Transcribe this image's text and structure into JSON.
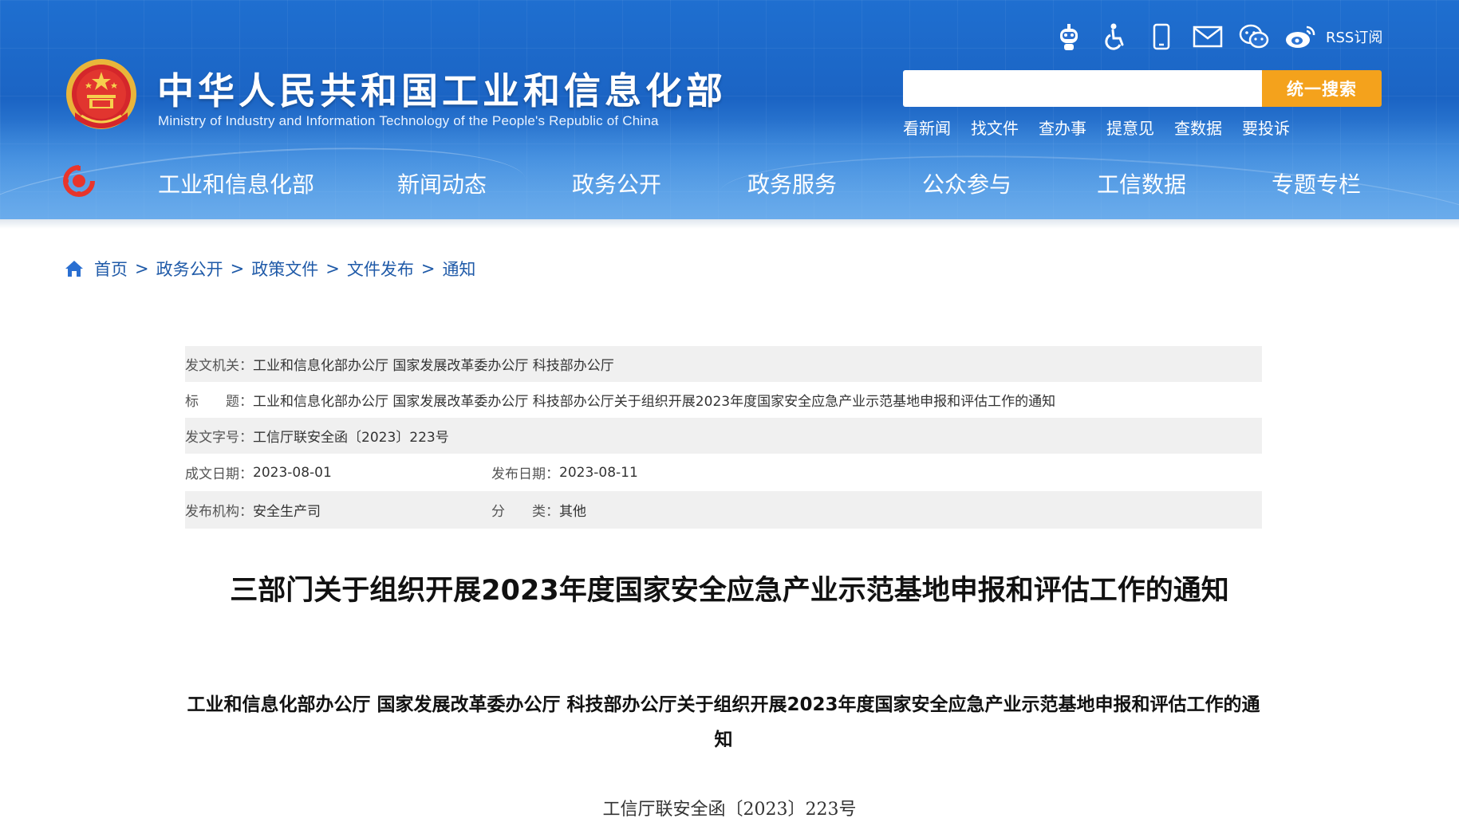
{
  "header": {
    "site_title": "中华人民共和国工业和信息化部",
    "site_subtitle": "Ministry of Industry and Information Technology of the People's Republic of China",
    "top_icons": [
      "robot-assistant-icon",
      "accessibility-icon",
      "mobile-icon",
      "mail-icon",
      "wechat-icon",
      "weibo-icon"
    ],
    "rss_label": "RSS订阅",
    "search": {
      "placeholder": "",
      "button_label": "统一搜索"
    },
    "quick_links": [
      "看新闻",
      "找文件",
      "查办事",
      "提意见",
      "查数据",
      "要投诉"
    ],
    "nav": [
      "工业和信息化部",
      "新闻动态",
      "政务公开",
      "政务服务",
      "公众参与",
      "工信数据",
      "专题专栏"
    ],
    "colors": {
      "header_blue": "#1f6fd0",
      "search_button": "#f4a21c"
    }
  },
  "breadcrumb": [
    "首页",
    "政务公开",
    "政策文件",
    "文件发布",
    "通知"
  ],
  "breadcrumb_sep": ">",
  "meta": {
    "issuer_label": "发文机关：",
    "issuer": "工业和信息化部办公厅 国家发展改革委办公厅 科技部办公厅",
    "title_label": "标　　题：",
    "title": "工业和信息化部办公厅 国家发展改革委办公厅 科技部办公厅关于组织开展2023年度国家安全应急产业示范基地申报和评估工作的通知",
    "doc_number_label": "发文字号：",
    "doc_number": "工信厅联安全函〔2023〕223号",
    "created_label": "成文日期：",
    "created": "2023-08-01",
    "published_label": "发布日期：",
    "published": "2023-08-11",
    "org_label": "发布机构：",
    "org": "安全生产司",
    "category_label": "分　　类：",
    "category": "其他"
  },
  "article": {
    "title": "三部门关于组织开展2023年度国家安全应急产业示范基地申报和评估工作的通知",
    "subtitle": "工业和信息化部办公厅  国家发展改革委办公厅  科技部办公厅关于组织开展2023年度国家安全应急产业示范基地申报和评估工作的通知",
    "doc_number": "工信厅联安全函〔2023〕223号"
  }
}
